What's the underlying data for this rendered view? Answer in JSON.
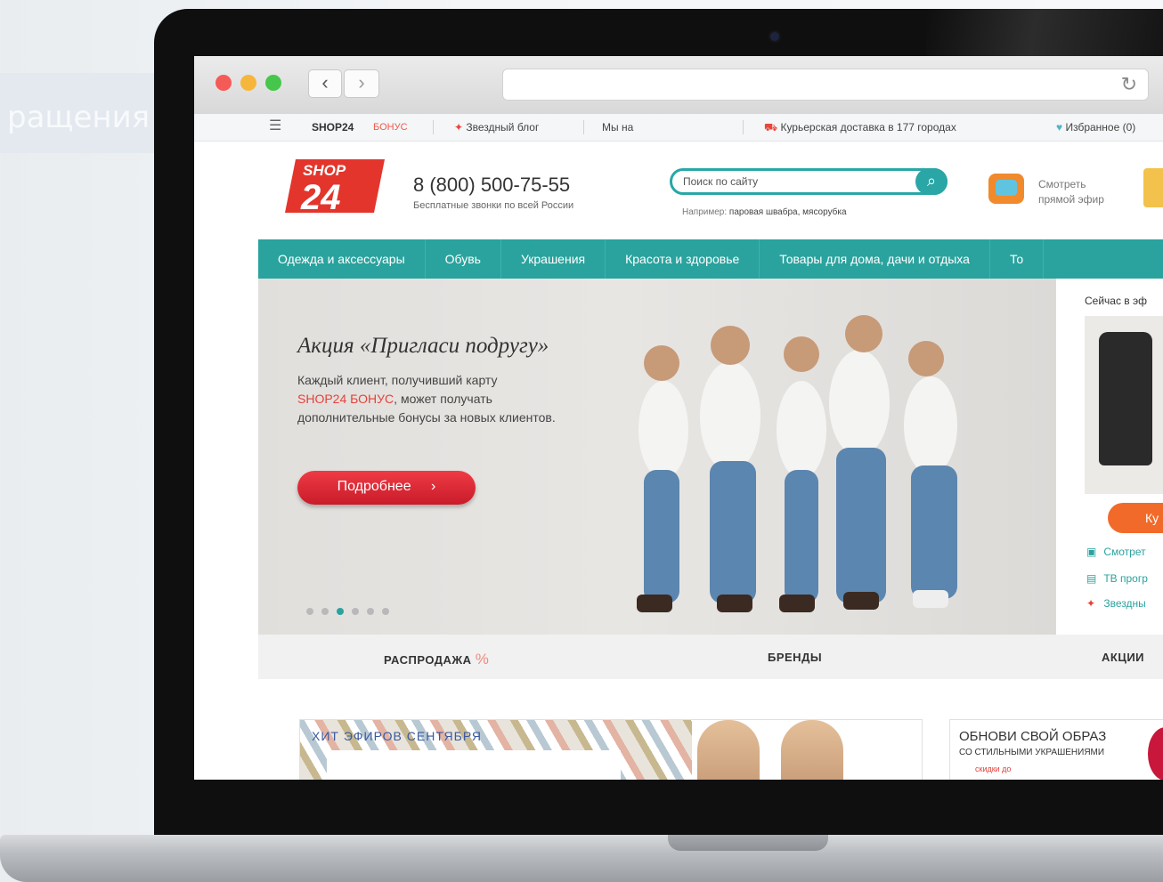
{
  "background": {
    "ghost_text": "ращения"
  },
  "browser": {
    "address_value": "",
    "back_glyph": "‹",
    "forward_glyph": "›",
    "reload_glyph": "↻"
  },
  "topbar": {
    "logo": "SHOP24",
    "bonus": "БОНУС",
    "blog": "Звездный блог",
    "social": "Мы на",
    "delivery": "Курьерская доставка в 177 городах",
    "favorites": "Избранное (0)"
  },
  "header": {
    "logo_line1": "SHOP",
    "logo_line2": "24",
    "phone": "8 (800) 500-75-55",
    "phone_note": "Бесплатные звонки по всей России",
    "search_placeholder": "Поиск по сайту",
    "search_hint_label": "Например:",
    "search_hint_examples": "паровая швабра, мясорубка",
    "live_line1": "Смотреть",
    "live_line2": "прямой эфир"
  },
  "nav": {
    "items": [
      "Одежда и аксессуары",
      "Обувь",
      "Украшения",
      "Красота и здоровье",
      "Товары для дома, дачи и отдыха",
      "То"
    ]
  },
  "hero": {
    "title": "Акция «Пригласи подругу»",
    "text_before": "Каждый клиент, получивший карту",
    "text_accent": "SHOP24 БОНУС",
    "text_after": ", может получать дополнительные бонусы за новых клиентов.",
    "button": "Подробнее",
    "button_arrow": "›",
    "slides": 6,
    "active_slide": 3
  },
  "sidebar": {
    "title": "Сейчас в эф",
    "buy_button": "Ку",
    "links": [
      "Смотрет",
      "ТВ прогр",
      "Звездны"
    ]
  },
  "tabs": {
    "sale": "РАСПРОДАЖА",
    "sale_mark": "%",
    "brands": "БРЕНДЫ",
    "promos": "АКЦИИ"
  },
  "promo": {
    "banner1_text": "ХИТ ЭФИРОВ СЕНТЯБРЯ",
    "banner2_title": "ОБНОВИ СВОЙ ОБРАЗ",
    "banner2_sub": "СО СТИЛЬНЫМИ УКРАШЕНИЯМИ",
    "banner2_tag": "скидки до"
  },
  "colors": {
    "teal": "#2aa39e",
    "brand_red": "#e5413a",
    "cta_red": "#d6202f",
    "orange": "#f26a2a"
  }
}
